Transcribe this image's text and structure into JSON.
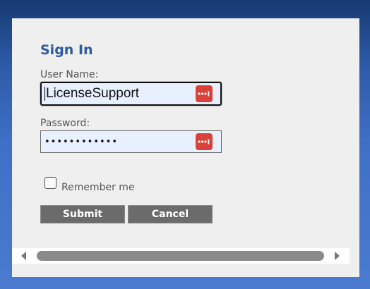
{
  "form": {
    "title": "Sign In",
    "username_label": "User Name:",
    "username_value": "LicenseSupport",
    "password_label": "Password:",
    "password_value": "••••••••••••",
    "remember_label": "Remember me",
    "remember_checked": false,
    "submit_label": "Submit",
    "cancel_label": "Cancel"
  },
  "icons": {
    "password_manager": "password-manager-icon",
    "scroll_left": "scroll-left-arrow-icon",
    "scroll_right": "scroll-right-arrow-icon"
  },
  "colors": {
    "title": "#2e5aa0",
    "panel": "#efefef",
    "input_bg": "#e8f0fe",
    "button_bg": "#6b6b6b",
    "password_manager_badge": "#d9423b"
  }
}
